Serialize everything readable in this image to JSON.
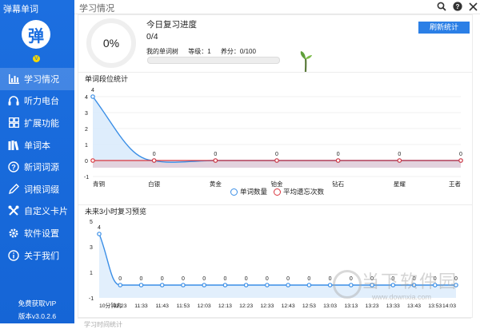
{
  "app": {
    "title": "弹幕单词",
    "logo_char": "弹",
    "badge": "V",
    "vip_label": "免费获取VIP",
    "version": "版本v3.0.2.6"
  },
  "sidebar": {
    "items": [
      {
        "label": "学习情况",
        "icon": "bar-chart-icon",
        "active": true
      },
      {
        "label": "听力电台",
        "icon": "headphones-icon"
      },
      {
        "label": "扩展功能",
        "icon": "grid-icon"
      },
      {
        "label": "单词本",
        "icon": "books-icon"
      },
      {
        "label": "新词词源",
        "icon": "question-icon"
      },
      {
        "label": "词根词缀",
        "icon": "pencil-icon"
      },
      {
        "label": "自定义卡片",
        "icon": "tools-icon"
      },
      {
        "label": "软件设置",
        "icon": "gear-icon"
      },
      {
        "label": "关于我们",
        "icon": "info-icon"
      }
    ]
  },
  "topbar": {
    "title": "学习情况",
    "icons": [
      "search-icon",
      "help-icon",
      "close-icon"
    ]
  },
  "today": {
    "percent": "0%",
    "title": "今日复习进度",
    "count": "0/4",
    "stat_words": "我的单词树",
    "stat_level": "等级：1",
    "stat_points": "养分：0/100",
    "refresh_label": "刷新统计",
    "nutrient_fraction": 0
  },
  "chart1_title": "单词段位统计",
  "chart2_title": "未来3小时复习预览",
  "chart3_title": "学习时间统计",
  "legend": {
    "series1": "单词数量",
    "series2": "平均遗忘次数"
  },
  "colors": {
    "primary": "#1c6fe0",
    "line_blue": "#3a8ee6",
    "line_red": "#d9363e",
    "fill_blue": "#d6e8fb",
    "fill_red": "#e2d2dd"
  },
  "chart_data": [
    {
      "type": "line",
      "title": "单词段位统计",
      "categories": [
        "青铜",
        "白银",
        "黄金",
        "铂金",
        "钻石",
        "星耀",
        "王者"
      ],
      "series": [
        {
          "name": "单词数量",
          "values": [
            4,
            0,
            0,
            0,
            0,
            0,
            0
          ]
        },
        {
          "name": "平均遗忘次数",
          "values": [
            0,
            0,
            0,
            0,
            0,
            0,
            0
          ]
        }
      ],
      "yticks": [
        "4",
        "3",
        "2",
        "1",
        "0",
        "-1"
      ],
      "ylim": [
        -1,
        4
      ],
      "legend": "bottom-center"
    },
    {
      "type": "line",
      "title": "未来3小时复习预览",
      "categories": [
        "10分钟内",
        "11:23",
        "11:33",
        "11:43",
        "11:53",
        "12:03",
        "12:13",
        "12:23",
        "12:33",
        "12:43",
        "12:53",
        "13:03",
        "13:13",
        "13:23",
        "13:33",
        "13:43",
        "13:53",
        "14:03"
      ],
      "series": [
        {
          "values": [
            4,
            0,
            0,
            0,
            0,
            0,
            0,
            0,
            0,
            0,
            0,
            0,
            0,
            0,
            0,
            0,
            0,
            0
          ]
        }
      ],
      "yticks": [
        "5",
        "3",
        "1",
        "-1"
      ],
      "ylim": [
        -1,
        5
      ]
    }
  ],
  "watermark": {
    "text": "当下软件园",
    "url": "www.downxia.com"
  }
}
